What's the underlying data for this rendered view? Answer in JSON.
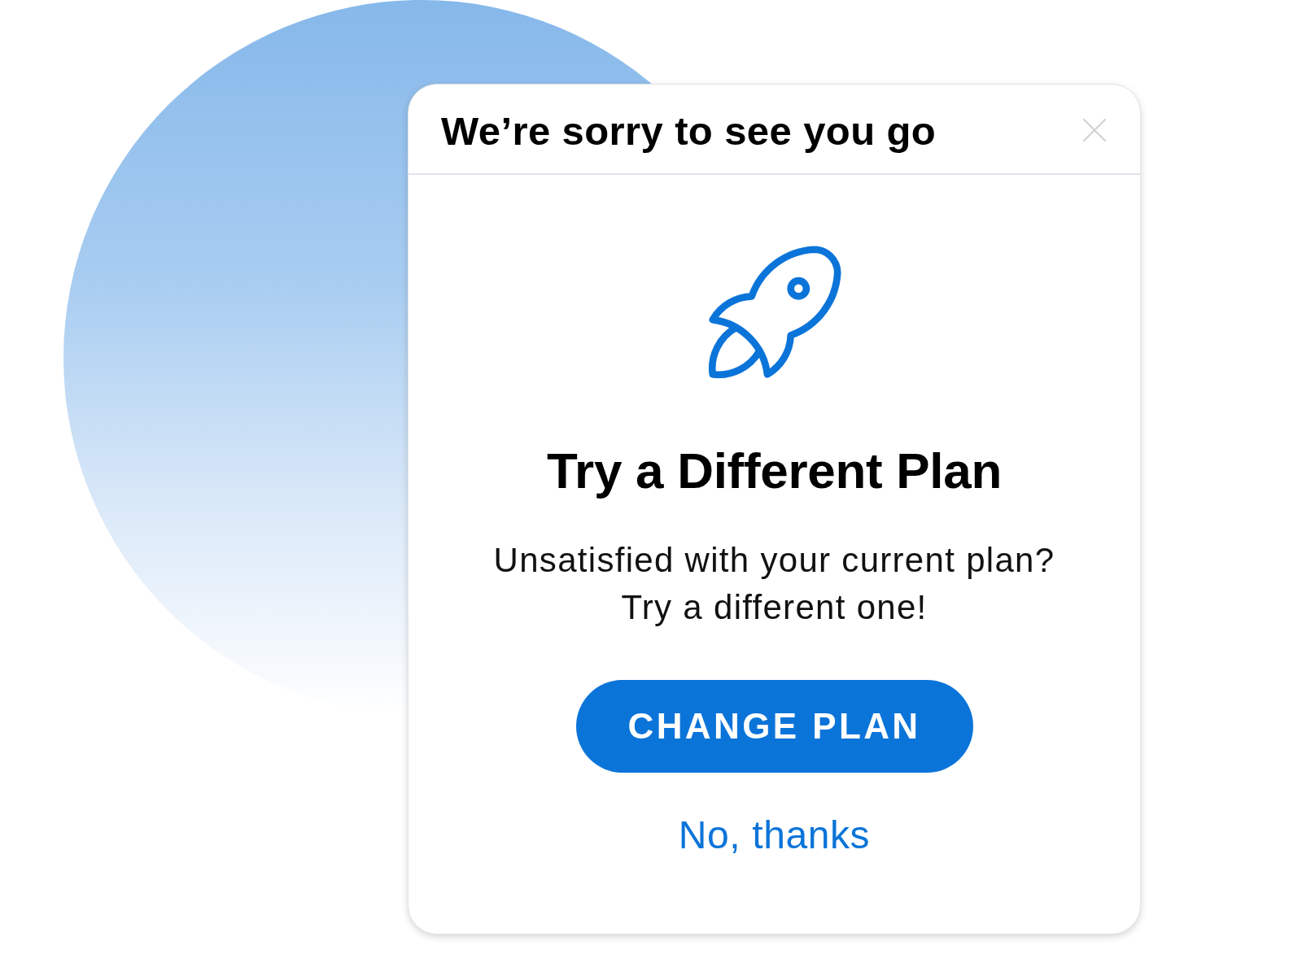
{
  "dialog": {
    "title": "We’re sorry to see you go",
    "offer": {
      "heading": "Try a Different Plan",
      "message": "Unsatisfied with your current plan?\nTry a different one!",
      "primary_button": "CHANGE PLAN",
      "secondary_link": "No, thanks"
    }
  }
}
